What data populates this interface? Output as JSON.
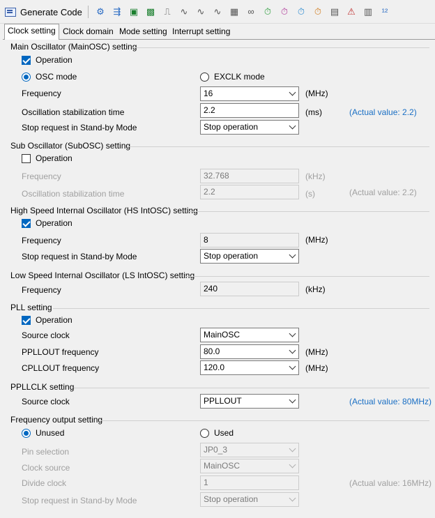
{
  "toolbar": {
    "generate_label": "Generate Code",
    "icons": [
      "pin-config-icon",
      "port-icon",
      "chip-icon",
      "board-icon",
      "transfer-icon",
      "wave-a-icon",
      "wave-b-icon",
      "wave-c-icon",
      "grid-icon",
      "link-icon",
      "timer-a-icon",
      "timer-b-icon",
      "timer-c-icon",
      "timer-d-icon",
      "table-icon",
      "warning-icon",
      "module-icon",
      "counter-icon"
    ],
    "icon_glyphs": [
      "⚙",
      "⇶",
      "▣",
      "▩",
      "⎍",
      "∿",
      "∿",
      "∿",
      "▦",
      "∞",
      "⏱",
      "⏱",
      "⏱",
      "⏱",
      "▤",
      "⚠",
      "▥",
      "¹²"
    ],
    "icon_colors": [
      "#2b6cc4",
      "#2b6cc4",
      "#1a7f2e",
      "#1a7f2e",
      "#555555",
      "#555555",
      "#555555",
      "#555555",
      "#555555",
      "#555555",
      "#2a9d3a",
      "#b03a9a",
      "#2a8ad0",
      "#d07a1a",
      "#555555",
      "#c03030",
      "#555555",
      "#2b6cc4"
    ]
  },
  "tabs": [
    "Clock setting",
    "Clock domain",
    "Mode setting",
    "Interrupt setting"
  ],
  "mainosc": {
    "title": "Main Oscillator (MainOSC) setting",
    "operation": "Operation",
    "osc_mode": "OSC mode",
    "exclk_mode": "EXCLK mode",
    "frequency_label": "Frequency",
    "frequency_value": "16",
    "frequency_unit": "(MHz)",
    "stab_label": "Oscillation stabilization time",
    "stab_value": "2.2",
    "stab_unit": "(ms)",
    "stab_actual": "(Actual value: 2.2)",
    "standby_label": "Stop request in Stand-by Mode",
    "standby_value": "Stop operation"
  },
  "subosc": {
    "title": "Sub Oscillator (SubOSC) setting",
    "operation": "Operation",
    "frequency_label": "Frequency",
    "frequency_value": "32.768",
    "frequency_unit": "(kHz)",
    "stab_label": "Oscillation stabilization time",
    "stab_value": "2.2",
    "stab_unit": "(s)",
    "stab_actual": "(Actual value: 2.2)"
  },
  "hsint": {
    "title": "High Speed Internal Oscillator (HS IntOSC) setting",
    "operation": "Operation",
    "frequency_label": "Frequency",
    "frequency_value": "8",
    "frequency_unit": "(MHz)",
    "standby_label": "Stop request in Stand-by Mode",
    "standby_value": "Stop operation"
  },
  "lsint": {
    "title": "Low Speed Internal Oscillator (LS IntOSC) setting",
    "frequency_label": "Frequency",
    "frequency_value": "240",
    "frequency_unit": "(kHz)"
  },
  "pll": {
    "title": "PLL setting",
    "operation": "Operation",
    "source_label": "Source clock",
    "source_value": "MainOSC",
    "pllout_label": "PPLLOUT frequency",
    "pllout_value": "80.0",
    "pllout_unit": "(MHz)",
    "cpllout_label": "CPLLOUT frequency",
    "cpllout_value": "120.0",
    "cpllout_unit": "(MHz)"
  },
  "ppllclk": {
    "title": "PPLLCLK setting",
    "source_label": "Source clock",
    "source_value": "PPLLOUT",
    "actual": "(Actual value: 80MHz)"
  },
  "freqout": {
    "title": "Frequency output setting",
    "unused": "Unused",
    "used": "Used",
    "pin_label": "Pin selection",
    "pin_value": "JP0_3",
    "clock_label": "Clock source",
    "clock_value": "MainOSC",
    "divide_label": "Divide clock",
    "divide_value": "1",
    "divide_actual": "(Actual value: 16MHz)",
    "standby_label": "Stop request in Stand-by Mode",
    "standby_value": "Stop operation"
  }
}
